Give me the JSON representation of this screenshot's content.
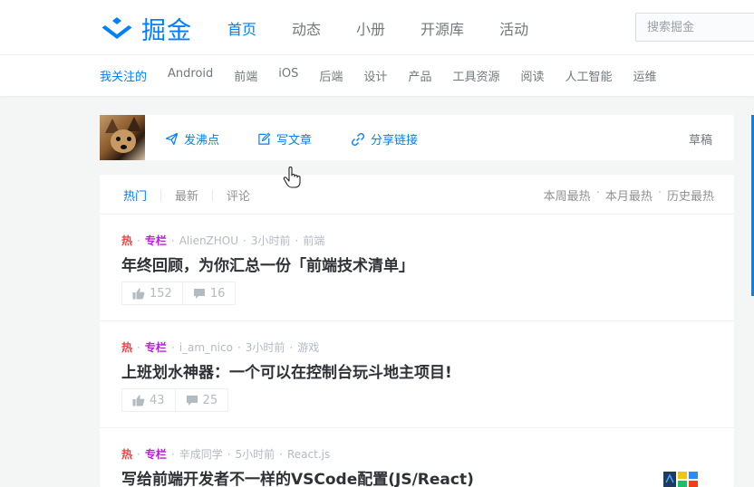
{
  "header": {
    "logo_text": "掘金",
    "nav": [
      "首页",
      "动态",
      "小册",
      "开源库",
      "活动"
    ],
    "active_nav": 0,
    "search_placeholder": "搜索掘金"
  },
  "subnav": {
    "tags": [
      "我关注的",
      "Android",
      "前端",
      "iOS",
      "后端",
      "设计",
      "产品",
      "工具资源",
      "阅读",
      "人工智能",
      "运维"
    ],
    "active_tag": 0
  },
  "composer": {
    "post_pin": "发沸点",
    "write_article": "写文章",
    "share_link": "分享链接",
    "drafts": "草稿"
  },
  "feed": {
    "tabs": [
      "热门",
      "最新",
      "评论"
    ],
    "active_tab": 0,
    "ranges": [
      "本周最热",
      "本月最热",
      "历史最热"
    ],
    "entries": [
      {
        "hot": "热",
        "column": "专栏",
        "author": "AlienZHOU",
        "time": "3小时前",
        "category": "前端",
        "title": "年终回顾，为你汇总一份「前端技术清单」",
        "likes": "152",
        "comments": "16"
      },
      {
        "hot": "热",
        "column": "专栏",
        "author": "i_am_nico",
        "time": "3小时前",
        "category": "游戏",
        "title": "上班划水神器：一个可以在控制台玩斗地主项目!",
        "likes": "43",
        "comments": "25"
      },
      {
        "hot": "热",
        "column": "专栏",
        "author": "辛成同学",
        "time": "5小时前",
        "category": "React.js",
        "title": "写给前端开发者不一样的VSCode配置(JS/React)"
      }
    ]
  },
  "colors": {
    "brand": "#007fff",
    "hot": "#f04142",
    "column": "#b71ed7"
  }
}
